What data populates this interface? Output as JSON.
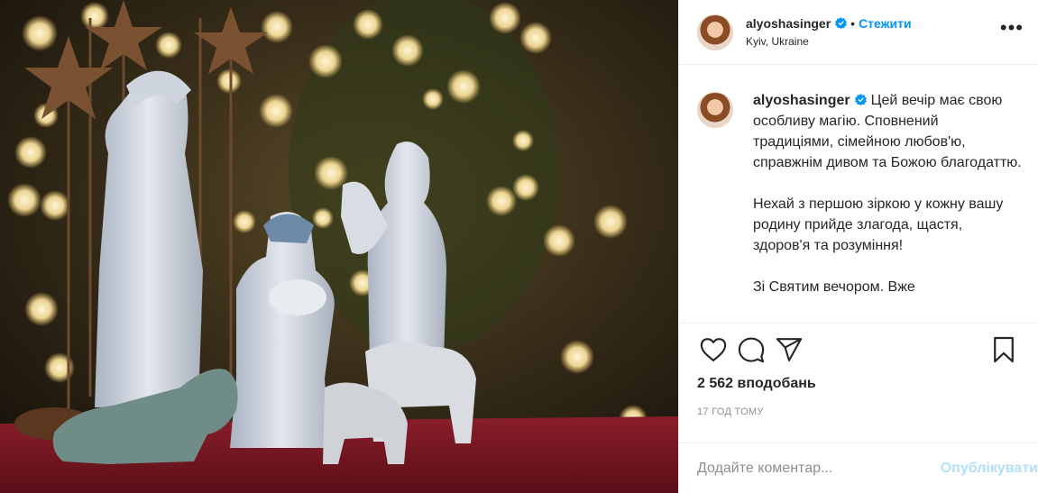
{
  "colors": {
    "accent": "#0095f6",
    "publish_disabled": "#b2dffc",
    "muted": "#8e8e8e"
  },
  "header": {
    "username": "alyoshasinger",
    "dot": "•",
    "follow_label": "Стежити",
    "location": "Kyiv, Ukraine",
    "more_icon": "more-horizontal-icon"
  },
  "caption": {
    "username": "alyoshasinger",
    "paragraphs": [
      "Цей вечір має свою особливу магію. Сповнений традиціями, сімейною любов'ю, справжнім дивом та Божою благодаттю.",
      "Нехай з першою зіркою у кожну вашу родину прийде злагода, щастя, здоров'я та розуміння!",
      "Зі Святим вечором. Вже"
    ]
  },
  "actions": {
    "icons": [
      "heart-icon",
      "comment-icon",
      "share-icon",
      "bookmark-icon"
    ]
  },
  "likes": "2 562 вподобань",
  "timestamp": "17 ГОД ТОМУ",
  "comment_box": {
    "placeholder": "Додайте коментар...",
    "publish_label": "Опублікувати"
  }
}
